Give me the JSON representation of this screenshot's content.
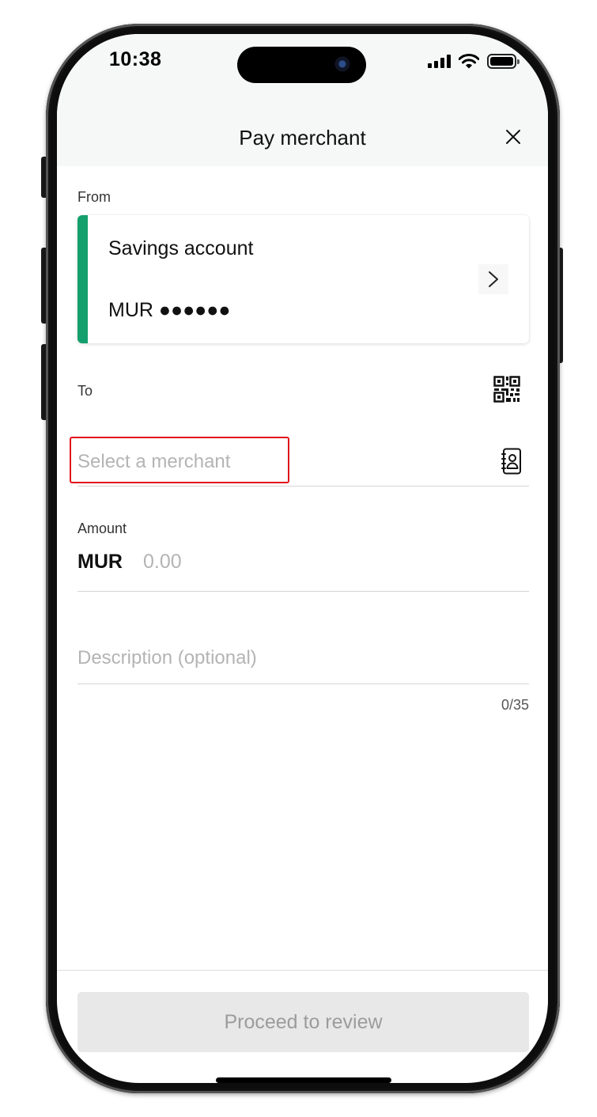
{
  "status_bar": {
    "time": "10:38",
    "icons": [
      "signal-icon",
      "wifi-icon",
      "battery-icon"
    ]
  },
  "header": {
    "title": "Pay merchant",
    "close_icon": "close-icon"
  },
  "from": {
    "label": "From",
    "account_name": "Savings account",
    "account_number": "MUR ●●●●●●",
    "accent_color": "#13a06d"
  },
  "to": {
    "label": "To",
    "merchant_placeholder": "Select a merchant",
    "qr_icon": "qr-code-icon",
    "contacts_icon": "contact-book-icon"
  },
  "amount": {
    "label": "Amount",
    "currency": "MUR",
    "placeholder": "0.00"
  },
  "description": {
    "placeholder": "Description (optional)",
    "counter": "0/35"
  },
  "footer": {
    "proceed_label": "Proceed to review"
  },
  "colors": {
    "highlight": "#e0161b",
    "button_disabled": "#e8e8e8"
  }
}
